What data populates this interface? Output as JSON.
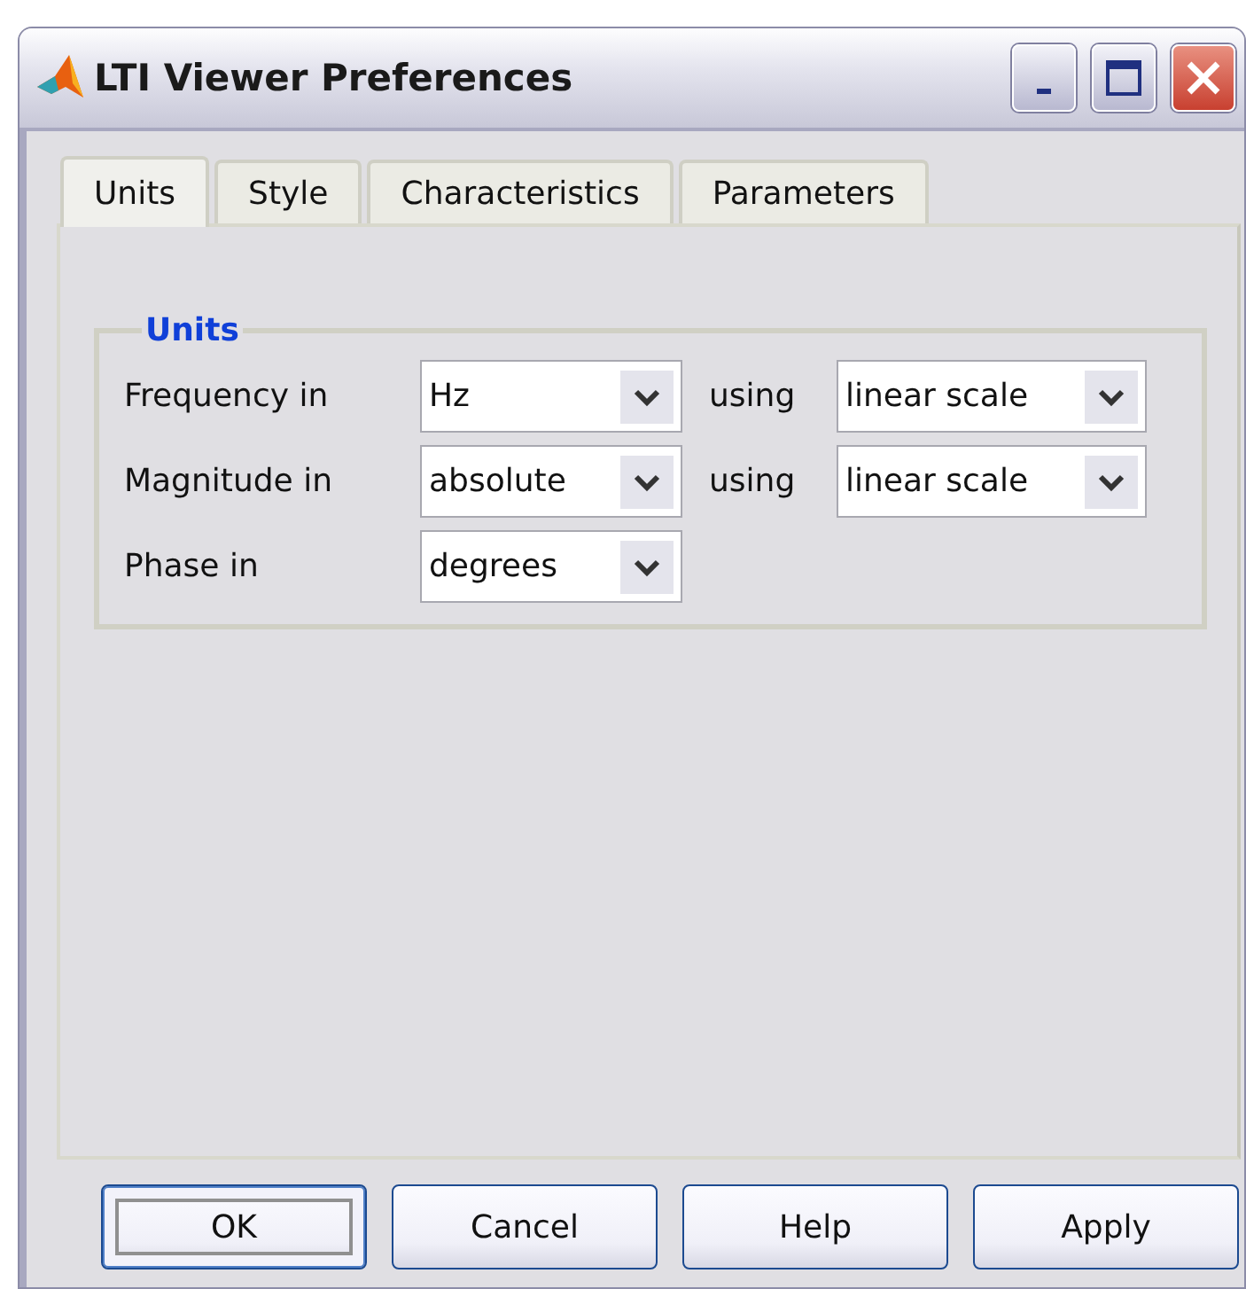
{
  "window": {
    "title": "LTI Viewer Preferences"
  },
  "tabs": [
    {
      "label": "Units",
      "selected": true
    },
    {
      "label": "Style",
      "selected": false
    },
    {
      "label": "Characteristics",
      "selected": false
    },
    {
      "label": "Parameters",
      "selected": false
    }
  ],
  "group": {
    "title": "Units",
    "rows": [
      {
        "label": "Frequency in",
        "value": "Hz",
        "connector": "using",
        "scale": "linear scale"
      },
      {
        "label": "Magnitude in",
        "value": "absolute",
        "connector": "using",
        "scale": "linear scale"
      },
      {
        "label": "Phase in",
        "value": "degrees"
      }
    ]
  },
  "buttons": [
    {
      "label": "OK",
      "default": true
    },
    {
      "label": "Cancel",
      "default": false
    },
    {
      "label": "Help",
      "default": false
    },
    {
      "label": "Apply",
      "default": false
    }
  ]
}
